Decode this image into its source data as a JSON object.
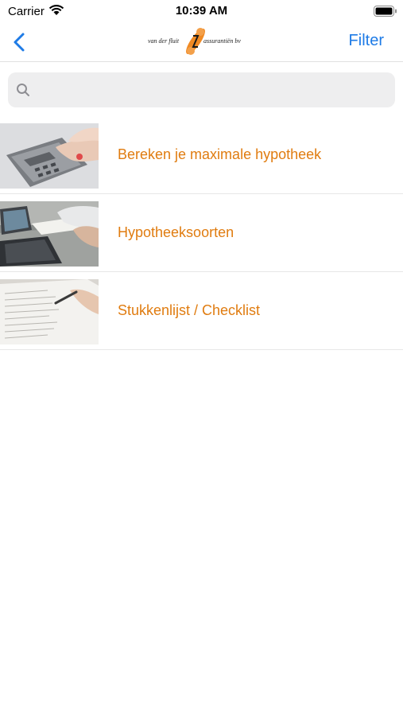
{
  "status_bar": {
    "carrier": "Carrier",
    "time": "10:39 AM"
  },
  "nav": {
    "logo_left": "van der fluit",
    "logo_right": "assurantiën bv",
    "filter_label": "Filter"
  },
  "search": {
    "placeholder": ""
  },
  "list": {
    "items": [
      {
        "title": "Bereken je maximale hypotheek",
        "image": "calculator-photo"
      },
      {
        "title": "Hypotheeksoorten",
        "image": "laptop-meeting-photo"
      },
      {
        "title": "Stukkenlijst / Checklist",
        "image": "checklist-document-photo"
      }
    ]
  },
  "colors": {
    "accent": "#1e7be6",
    "item_title": "#e07c10",
    "search_bg": "#eeeeef",
    "logo_orange": "#f08a24"
  }
}
